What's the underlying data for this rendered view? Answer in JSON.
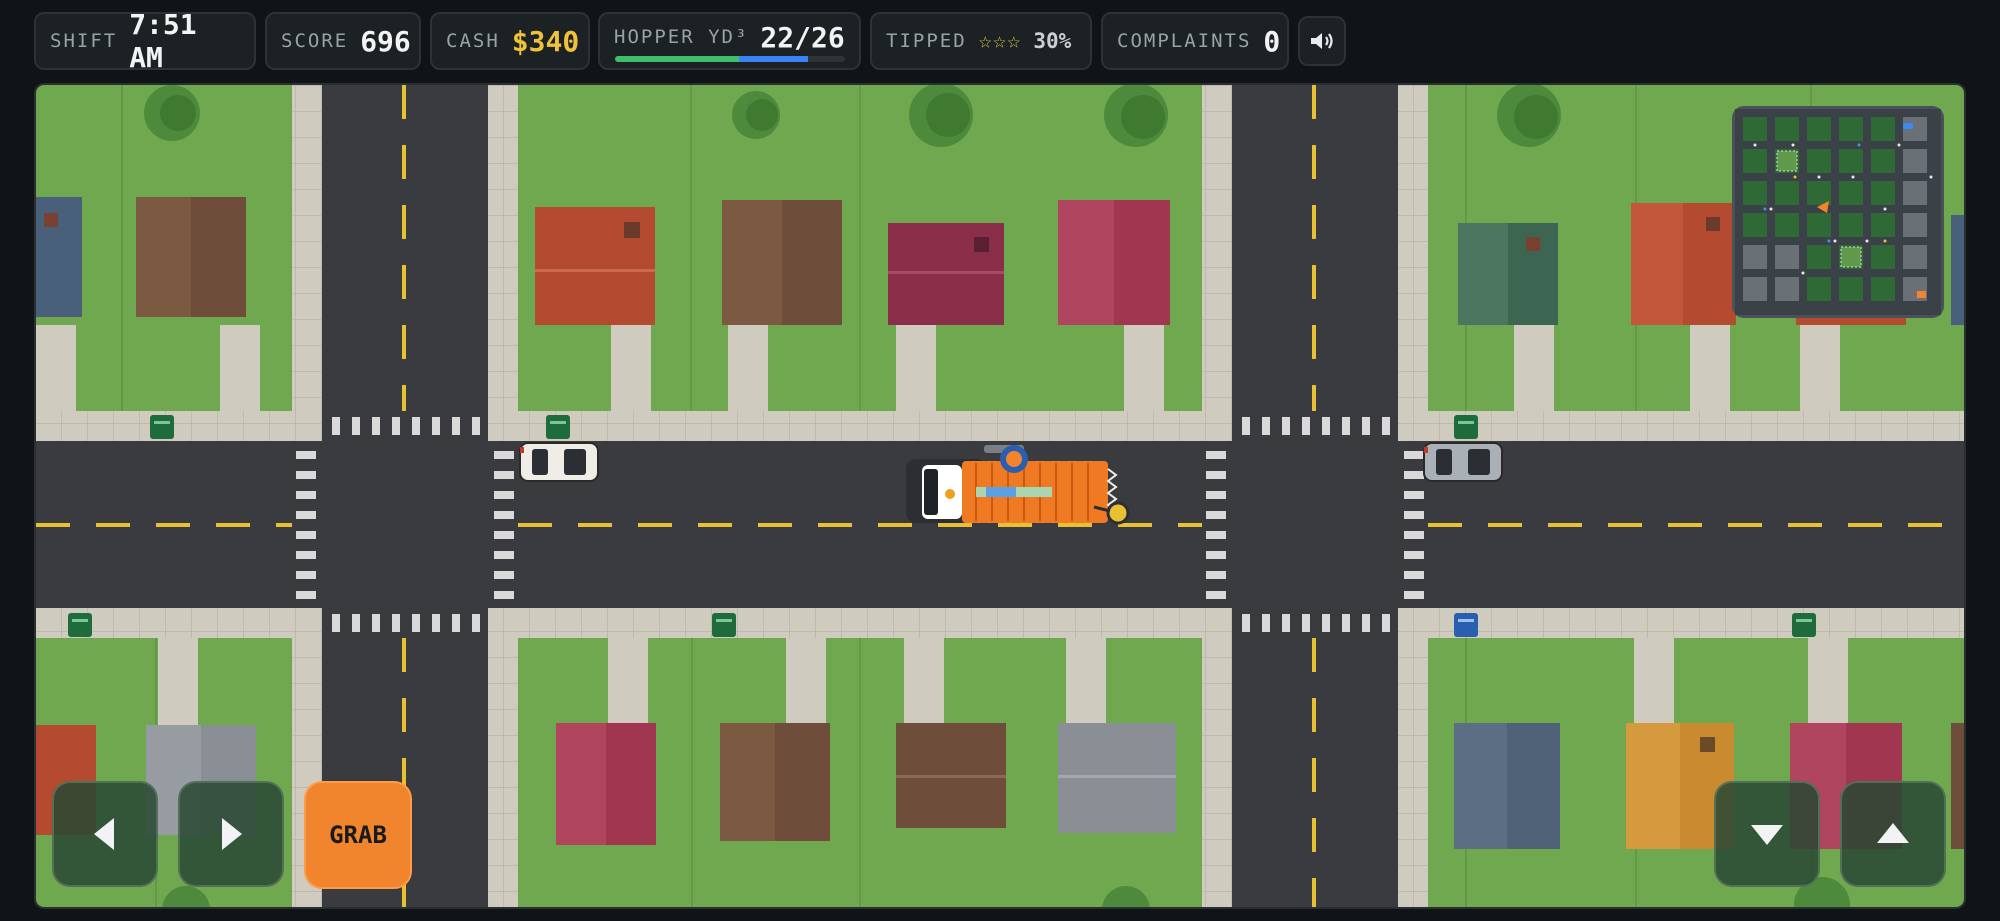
{
  "hud": {
    "shift": {
      "label": "SHIFT",
      "value": "7:51 AM"
    },
    "score": {
      "label": "SCORE",
      "value": "696"
    },
    "cash": {
      "label": "CASH",
      "value": "$340"
    },
    "hopper": {
      "label": "HOPPER YD³",
      "value": "22/26",
      "fill_green": 0.54,
      "fill_blue": 0.3
    },
    "tipped": {
      "label": "TIPPED",
      "stars": "☆☆☆",
      "percent": "30%"
    },
    "complaints": {
      "label": "COMPLAINTS",
      "value": "0"
    },
    "sound_icon": "speaker-icon"
  },
  "controls": {
    "left_icon": "arrow-left-icon",
    "right_icon": "arrow-right-icon",
    "grab_label": "GRAB",
    "down_icon": "arrow-down-icon",
    "up_icon": "arrow-up-icon"
  },
  "colors": {
    "grass": "#6fa84f",
    "road": "#3a3b3e",
    "truck": "#ef7a23",
    "accent_yellow": "#f0c23a"
  }
}
